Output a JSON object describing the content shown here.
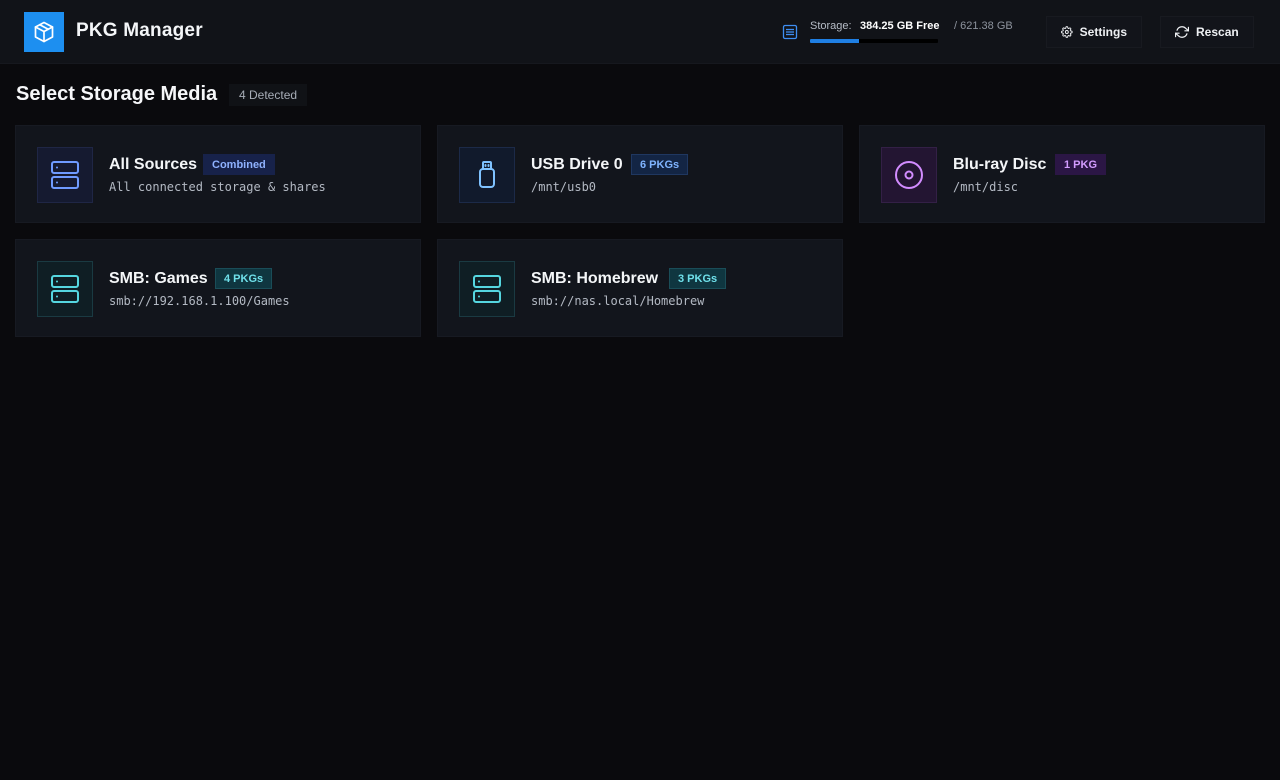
{
  "header": {
    "app_title": "PKG Manager",
    "logo_icon": "package-box-icon",
    "storage": {
      "label": "Storage:",
      "free": "384.25 GB Free",
      "total": "/ 621.38 GB",
      "used_fraction": 0.38
    },
    "settings_label": "Settings",
    "rescan_label": "Rescan"
  },
  "main": {
    "title": "Select Storage Media",
    "detected": "4 Detected",
    "sources": [
      {
        "title": "All Sources",
        "badge": "Combined",
        "subtitle": "All connected storage & shares",
        "icon": "server-stack-icon",
        "color": "#6f9bff"
      },
      {
        "title": "USB Drive 0",
        "badge": "6 PKGs",
        "subtitle": "/mnt/usb0",
        "icon": "usb-drive-icon",
        "color": "#7fc2ff"
      },
      {
        "title": "Blu-ray Disc",
        "badge": "1 PKG",
        "subtitle": "/mnt/disc",
        "icon": "disc-icon",
        "color": "#d28cff"
      },
      {
        "title": "SMB: Games",
        "badge": "4 PKGs",
        "subtitle": "smb://192.168.1.100/Games",
        "icon": "network-server-icon",
        "color": "#55d6e0"
      },
      {
        "title": "SMB: Homebrew",
        "badge": "3 PKGs",
        "subtitle": "smb://nas.local/Homebrew",
        "icon": "network-server-icon",
        "color": "#55d6e0"
      }
    ]
  }
}
